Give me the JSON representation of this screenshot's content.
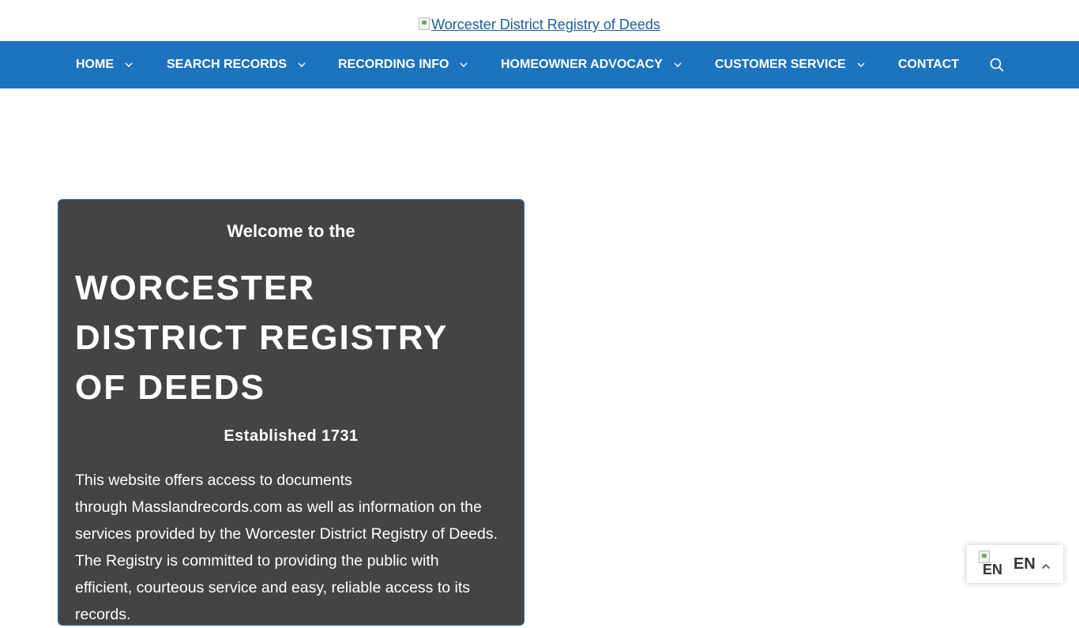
{
  "logo": {
    "alt_text": "Worcester District Registry of Deeds"
  },
  "nav": {
    "items": [
      {
        "label": "HOME",
        "has_dropdown": true
      },
      {
        "label": "SEARCH RECORDS",
        "has_dropdown": true
      },
      {
        "label": "RECORDING INFO",
        "has_dropdown": true
      },
      {
        "label": "HOMEOWNER ADVOCACY",
        "has_dropdown": true
      },
      {
        "label": "CUSTOMER SERVICE",
        "has_dropdown": true
      },
      {
        "label": "CONTACT",
        "has_dropdown": false
      }
    ],
    "search_icon": "search-icon"
  },
  "hero": {
    "welcome": "Welcome to the",
    "title_line1": "WORCESTER",
    "title_line2": "DISTRICT REGISTRY",
    "title_line3": "OF DEEDS",
    "established": "Established 1731",
    "intro_line1": "This website offers access to documents",
    "intro_line2": "through  Masslandrecords.com as well as information on the",
    "intro_line3": "services provided by the Worcester District Registry of Deeds.",
    "intro_line4": "The Registry is committed to providing the public with",
    "intro_line5": "efficient, courteous service and easy, reliable access to its",
    "intro_line6": "records."
  },
  "language": {
    "flag_alt": "EN",
    "current": "EN",
    "caret_icon": "chevron-up-icon"
  },
  "colors": {
    "nav_bg": "#1e73be",
    "card_bg": "#444444",
    "link": "#1b5e9b"
  }
}
